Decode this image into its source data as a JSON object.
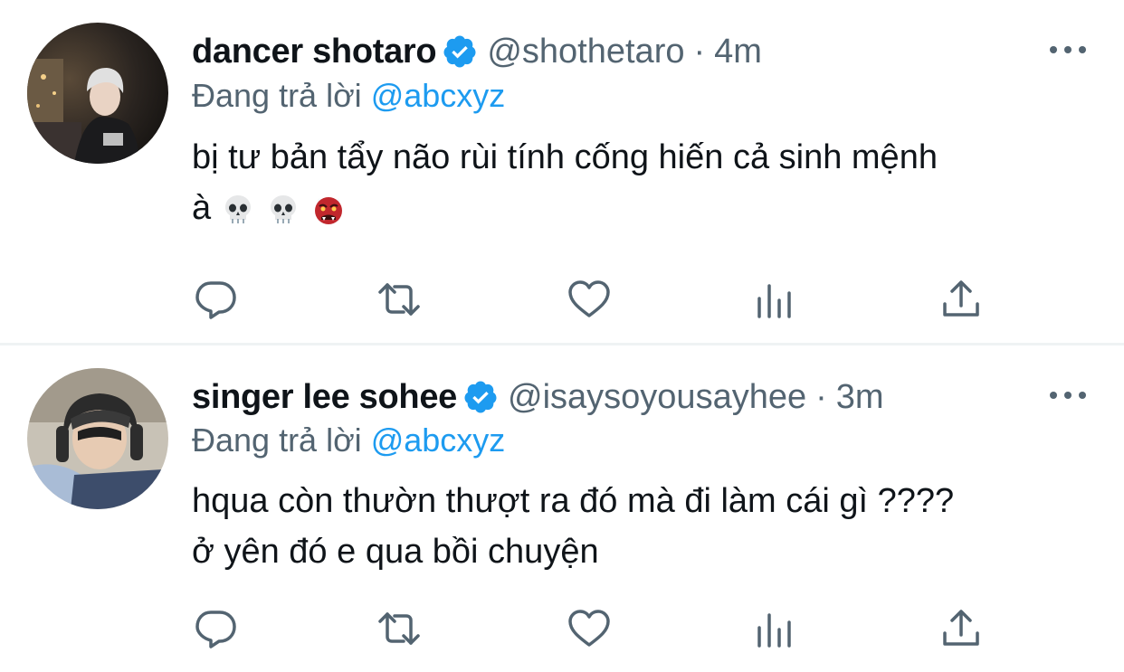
{
  "colors": {
    "text_primary": "#0f1419",
    "text_secondary": "#536471",
    "accent": "#1d9bf0",
    "divider": "#eff3f4"
  },
  "reply_prefix": "Đang trả lời",
  "tweets": [
    {
      "display_name": "dancer shotaro",
      "verified": true,
      "handle": "@shothetaro",
      "separator": "·",
      "time": "4m",
      "replying_to": "@abcxyz",
      "text_lines": [
        "bị tư bản tẩy não rùi tính cống hiến cả sinh mệnh",
        "à"
      ],
      "emojis": [
        "skull-emoji",
        "skull-emoji",
        "ogre-emoji"
      ]
    },
    {
      "display_name": "singer lee sohee",
      "verified": true,
      "handle": "@isaysoyousayhee",
      "separator": "·",
      "time": "3m",
      "replying_to": "@abcxyz",
      "text_lines": [
        "hqua còn thườn thượt ra đó mà đi làm cái gì ????",
        "ở yên đó e qua bồi chuyện"
      ],
      "emojis": []
    }
  ],
  "action_icons": [
    "reply-icon",
    "retweet-icon",
    "like-icon",
    "analytics-icon",
    "share-icon"
  ]
}
